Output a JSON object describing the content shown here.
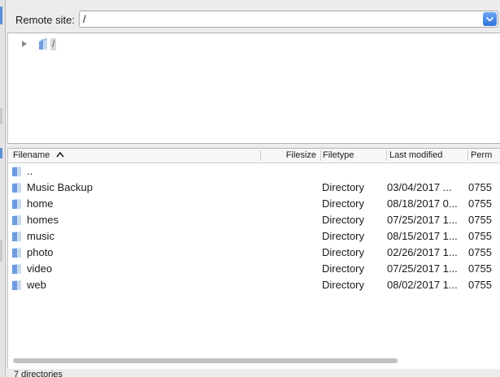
{
  "site_bar": {
    "label": "Remote site:",
    "path_value": "/",
    "dropdown_icon": "chevron-down-icon"
  },
  "tree": {
    "root_label": "/",
    "expand_icon": "disclosure-triangle-icon",
    "folder_icon": "folder-icon"
  },
  "list": {
    "columns": {
      "filename": "Filename",
      "filesize": "Filesize",
      "filetype": "Filetype",
      "last_modified": "Last modified",
      "permissions": "Perm"
    },
    "sort_icon": "sort-ascending-icon",
    "rows": [
      {
        "name": "..",
        "size": "",
        "type": "",
        "modified": "",
        "perms": ""
      },
      {
        "name": "Music Backup",
        "size": "",
        "type": "Directory",
        "modified": "03/04/2017 ...",
        "perms": "0755"
      },
      {
        "name": "home",
        "size": "",
        "type": "Directory",
        "modified": "08/18/2017 0...",
        "perms": "0755"
      },
      {
        "name": "homes",
        "size": "",
        "type": "Directory",
        "modified": "07/25/2017 1...",
        "perms": "0755"
      },
      {
        "name": "music",
        "size": "",
        "type": "Directory",
        "modified": "08/15/2017 1...",
        "perms": "0755"
      },
      {
        "name": "photo",
        "size": "",
        "type": "Directory",
        "modified": "02/26/2017 1...",
        "perms": "0755"
      },
      {
        "name": "video",
        "size": "",
        "type": "Directory",
        "modified": "07/25/2017 1...",
        "perms": "0755"
      },
      {
        "name": "web",
        "size": "",
        "type": "Directory",
        "modified": "08/02/2017 1...",
        "perms": "0755"
      }
    ]
  },
  "status": {
    "text": "7 directories"
  },
  "colors": {
    "accent": "#2f74dc",
    "folder": "#5b8fd6"
  }
}
